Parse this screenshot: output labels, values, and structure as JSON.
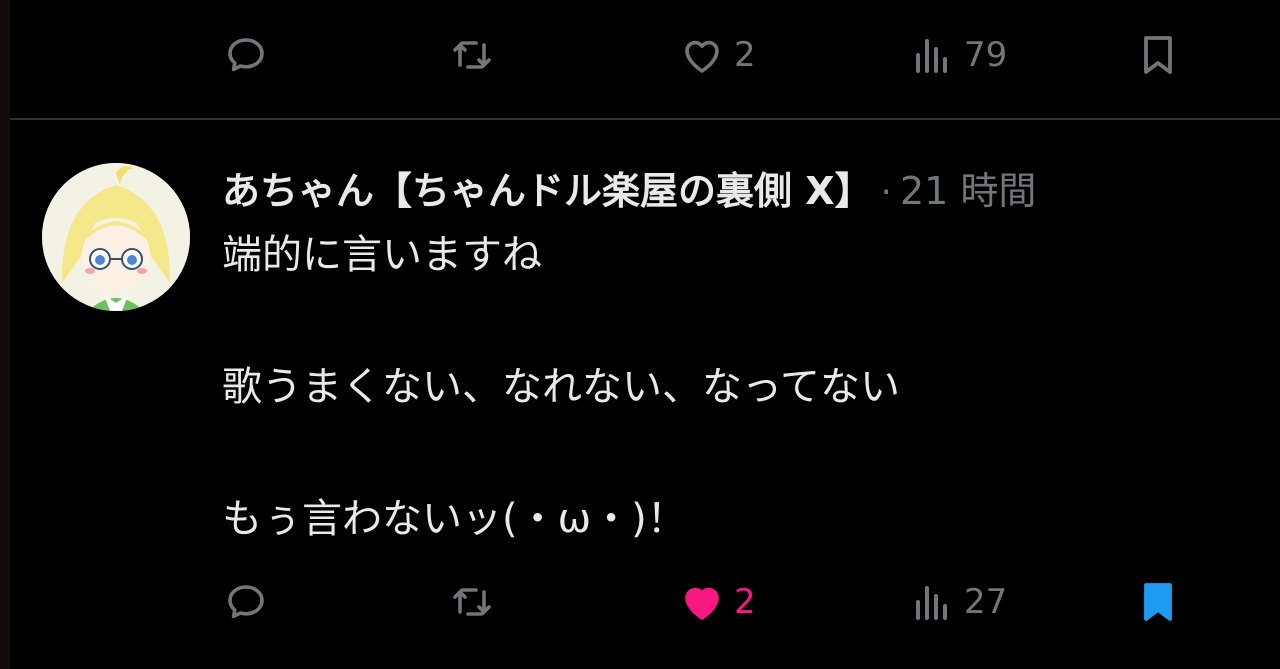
{
  "previous_post": {
    "actions": {
      "reply_count": "",
      "repost_count": "",
      "like_count": "2",
      "views_count": "79",
      "liked": false,
      "bookmarked": false
    }
  },
  "post": {
    "author_name": "あちゃん【ちゃんドル楽屋の裏側 X】",
    "separator": "·",
    "timestamp": "21 時間",
    "lines": [
      "端的に言いますね",
      "",
      "歌うまくない、なれない、なってない",
      "",
      "もぅ言わないッ(・ω・)！"
    ],
    "actions": {
      "reply_count": "",
      "repost_count": "",
      "like_count": "2",
      "views_count": "27",
      "liked": true,
      "bookmarked": true
    }
  },
  "colors": {
    "background": "#000000",
    "text": "#e7e9ea",
    "muted": "#71767b",
    "like_active": "#f91880",
    "bookmark_active": "#1d9bf0",
    "divider": "#2f3336"
  },
  "icons": [
    "reply-icon",
    "repost-icon",
    "heart-icon",
    "views-icon",
    "bookmark-icon"
  ]
}
